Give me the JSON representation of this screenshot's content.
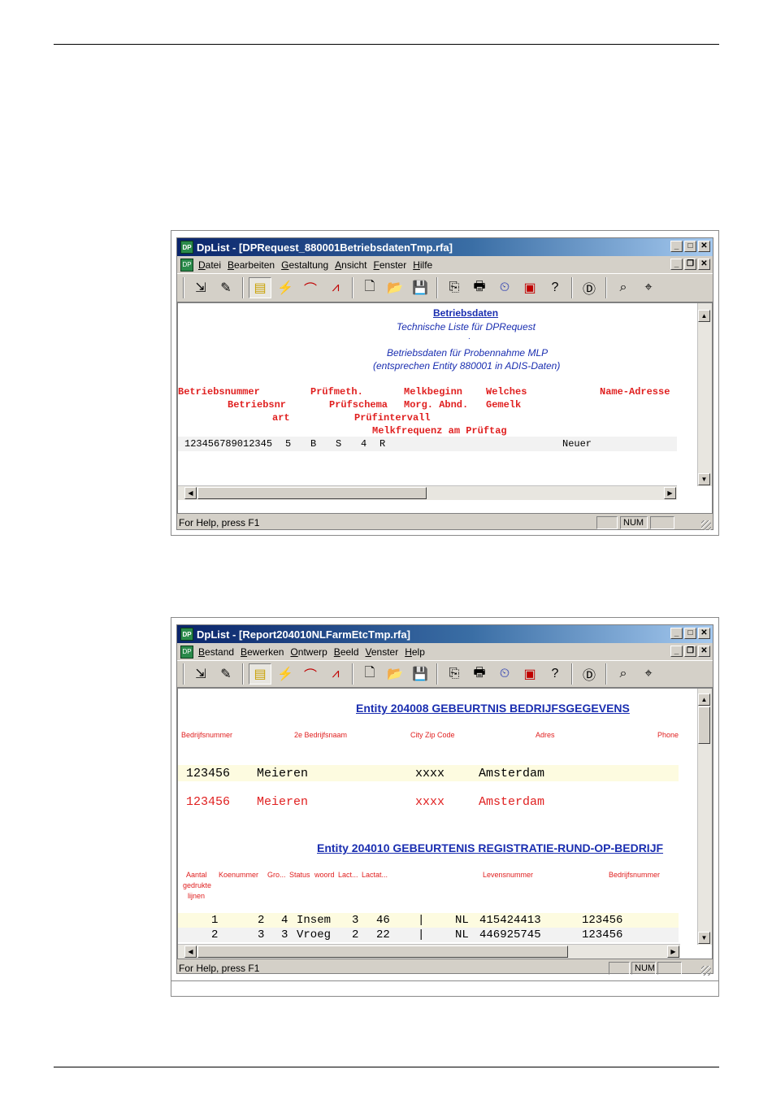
{
  "window1": {
    "title": "DpList - [DPRequest_880001BetriebsdatenTmp.rfa]",
    "menu": [
      "Datei",
      "Bearbeiten",
      "Gestaltung",
      "Ansicht",
      "Fenster",
      "Hilfe"
    ],
    "report": {
      "title": "Betriebsdaten",
      "subtitle": "Technische Liste für DPRequest",
      "dot": ".",
      "line3": "Betriebsdaten für Probennahme MLP",
      "line4": "(entsprechen Entity 880001 in ADIS-Daten)",
      "headers": {
        "row1": [
          "Betriebsnummer",
          "Prüfmeth.",
          "Melkbeginn",
          "Welches",
          "Name-Adresse"
        ],
        "row2": [
          "Betriebsnr",
          "Prüfschema",
          "Morg. Abnd.",
          "Gemelk"
        ],
        "row3": [
          "art",
          "Prüfintervall"
        ],
        "row4": [
          "Melkfrequenz am Prüftag"
        ]
      },
      "data_row": [
        "123456789012345",
        "5",
        "B",
        "S",
        "4",
        "R",
        "Neuer"
      ]
    },
    "status": {
      "help": "For Help, press F1",
      "num": "NUM"
    }
  },
  "window2": {
    "title": "DpList - [Report204010NLFarmEtcTmp.rfa]",
    "menu": [
      "Bestand",
      "Bewerken",
      "Ontwerp",
      "Beeld",
      "Venster",
      "Help"
    ],
    "report": {
      "section1_title": "Entity 204008 GEBEURTNIS BEDRIJFSGEGEVENS",
      "section1_headers": [
        "Bedrijfsnummer",
        "2e Bedrijfsnaam",
        "City Zip Code",
        "Adres",
        "Phone"
      ],
      "section1_row1": [
        "123456",
        "Meieren",
        "xxxx",
        "Amsterdam"
      ],
      "section1_row2": [
        "123456",
        "Meieren",
        "xxxx",
        "Amsterdam"
      ],
      "section2_title": "Entity 204010 GEBEURTENIS REGISTRATIE-RUND-OP-BEDRIJF",
      "section2_headers": [
        "Aantal",
        "gedrukte",
        "lijnen",
        "Koenummer",
        "Gro...",
        "Status",
        "woord",
        "Lact...",
        "Lactat...",
        "Levensnummer",
        "Bedrijfsnummer"
      ],
      "rows": [
        [
          "1",
          "2",
          "4",
          "Insem",
          "3",
          "46",
          "|",
          "NL",
          "415424413",
          "123456"
        ],
        [
          "2",
          "3",
          "3",
          "Vroeg",
          "2",
          "22",
          "|",
          "NL",
          "446925745",
          "123456"
        ]
      ]
    },
    "status": {
      "help": "For Help, press F1",
      "num": "NUM"
    }
  }
}
